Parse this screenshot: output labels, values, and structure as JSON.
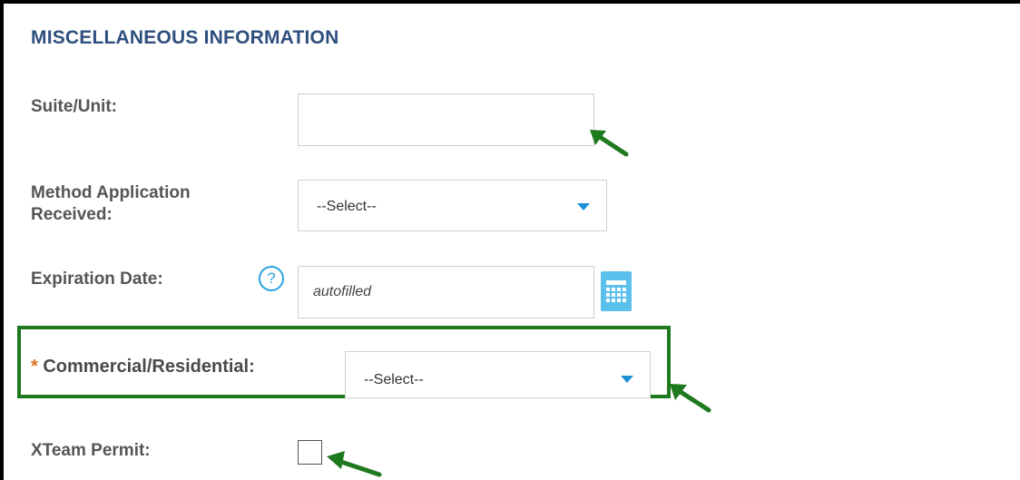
{
  "section": {
    "title": "MISCELLANEOUS INFORMATION"
  },
  "fields": {
    "suite_unit": {
      "label": "Suite/Unit:",
      "value": ""
    },
    "method_application": {
      "label_line1": "Method Application",
      "label_line2": "Received:",
      "selected": "--Select--"
    },
    "expiration_date": {
      "label": "Expiration Date:",
      "help_glyph": "?",
      "placeholder": "autofilled"
    },
    "commercial_residential": {
      "required_mark": "*",
      "label": "Commercial/Residential:",
      "selected": "--Select--"
    },
    "xteam_permit": {
      "label": "XTeam Permit:",
      "checked": false
    }
  },
  "colors": {
    "title": "#2f4f7f",
    "highlight": "#1f7a1f",
    "select_caret": "#1e90d6",
    "calendar": "#5bc0eb",
    "required": "#e07020"
  },
  "icons": [
    "help-circle-icon",
    "calendar-icon",
    "chevron-down-icon",
    "green-arrow-icon"
  ]
}
